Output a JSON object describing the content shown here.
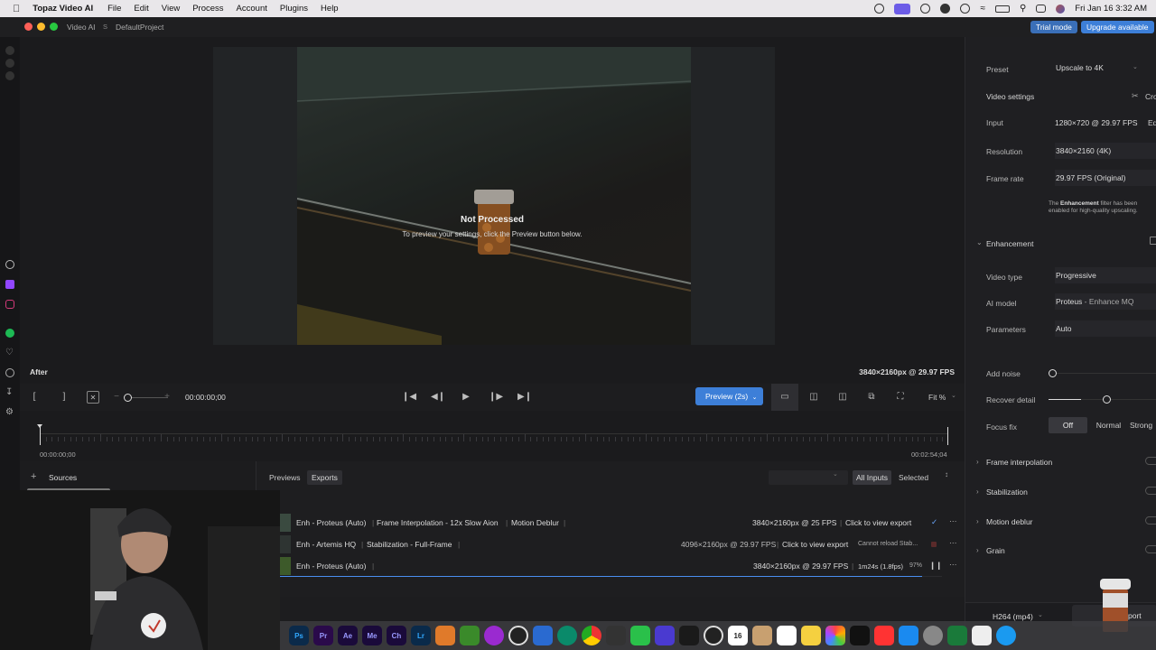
{
  "menubar": {
    "app_name": "Topaz Video AI",
    "menus": [
      "File",
      "Edit",
      "View",
      "Process",
      "Account",
      "Plugins",
      "Help"
    ],
    "clock": "Fri Jan 16  3:32 AM"
  },
  "titlebar": {
    "app": "Video AI",
    "badge": "S",
    "project": "DefaultProject",
    "trial_label": "Trial mode",
    "upgrade_label": "Upgrade available"
  },
  "viewer": {
    "status_title": "Not Processed",
    "status_sub": "To preview your settings, click the Preview button below.",
    "side_label": "After",
    "output_info": "3840×2160px @ 29.97 FPS"
  },
  "controls": {
    "timecode": "00:00:00;00",
    "preview_label": "Preview (2s)",
    "zoom_label": "Fit %"
  },
  "timeline": {
    "start": "00:00:00;00",
    "end": "00:02:54;04"
  },
  "lower": {
    "sources_label": "Sources",
    "tabs": [
      "Previews",
      "Exports"
    ],
    "filter_all": "All Inputs",
    "filter_selected": "Selected",
    "rows": [
      {
        "name": "Enh - Proteus (Auto)",
        "f2": "Frame Interpolation - 12x Slow Aion",
        "f3": "Motion Deblur",
        "res": "3840×2160px @ 25 FPS",
        "action": "Click to view export",
        "extra": ""
      },
      {
        "name": "Enh - Artemis HQ",
        "f2": "Stabilization - Full-Frame",
        "f3": "",
        "res": "4096×2160px @ 29.97 FPS",
        "action": "Click to view export",
        "extra": "Cannot reload Stab..."
      },
      {
        "name": "Enh - Proteus (Auto)",
        "f2": "",
        "f3": "",
        "res": "3840×2160px @ 29.97 FPS",
        "action": "1m24s (1.8fps)",
        "extra": "97%"
      }
    ]
  },
  "rightpanel": {
    "preset_label": "Preset",
    "preset_value": "Upscale to 4K",
    "video_settings": "Video settings",
    "crop_label": "Cro",
    "input_label": "Input",
    "input_value": "1280×720 @ 29.97 FPS",
    "input_edit": "Ed",
    "resolution_label": "Resolution",
    "resolution_value": "3840×2160 (4K)",
    "framerate_label": "Frame rate",
    "framerate_value": "29.97 FPS (Original)",
    "note_pre": "The ",
    "note_bold": "Enhancement",
    "note_post": " filter has been enabled for high-quality upscaling.",
    "enhancement": "Enhancement",
    "videotype_label": "Video type",
    "videotype_value": "Progressive",
    "aimodel_label": "AI model",
    "aimodel_value": "Proteus",
    "aimodel_sub": " - Enhance MQ",
    "params_label": "Parameters",
    "params_value": "Auto",
    "addnoise_label": "Add noise",
    "addnoise_level": 0,
    "recover_label": "Recover detail",
    "recover_level": 0.5,
    "focusfix_label": "Focus fix",
    "focusfix_options": [
      "Off",
      "Normal",
      "Strong"
    ],
    "sections": [
      "Frame interpolation",
      "Stabilization",
      "Motion deblur",
      "Grain"
    ],
    "export_format": "H264 (mp4)",
    "export_btn": "port"
  },
  "dock": {
    "icons": [
      "Ps",
      "Pr",
      "Ae",
      "Me",
      "Ch",
      "Lr",
      "16"
    ]
  }
}
